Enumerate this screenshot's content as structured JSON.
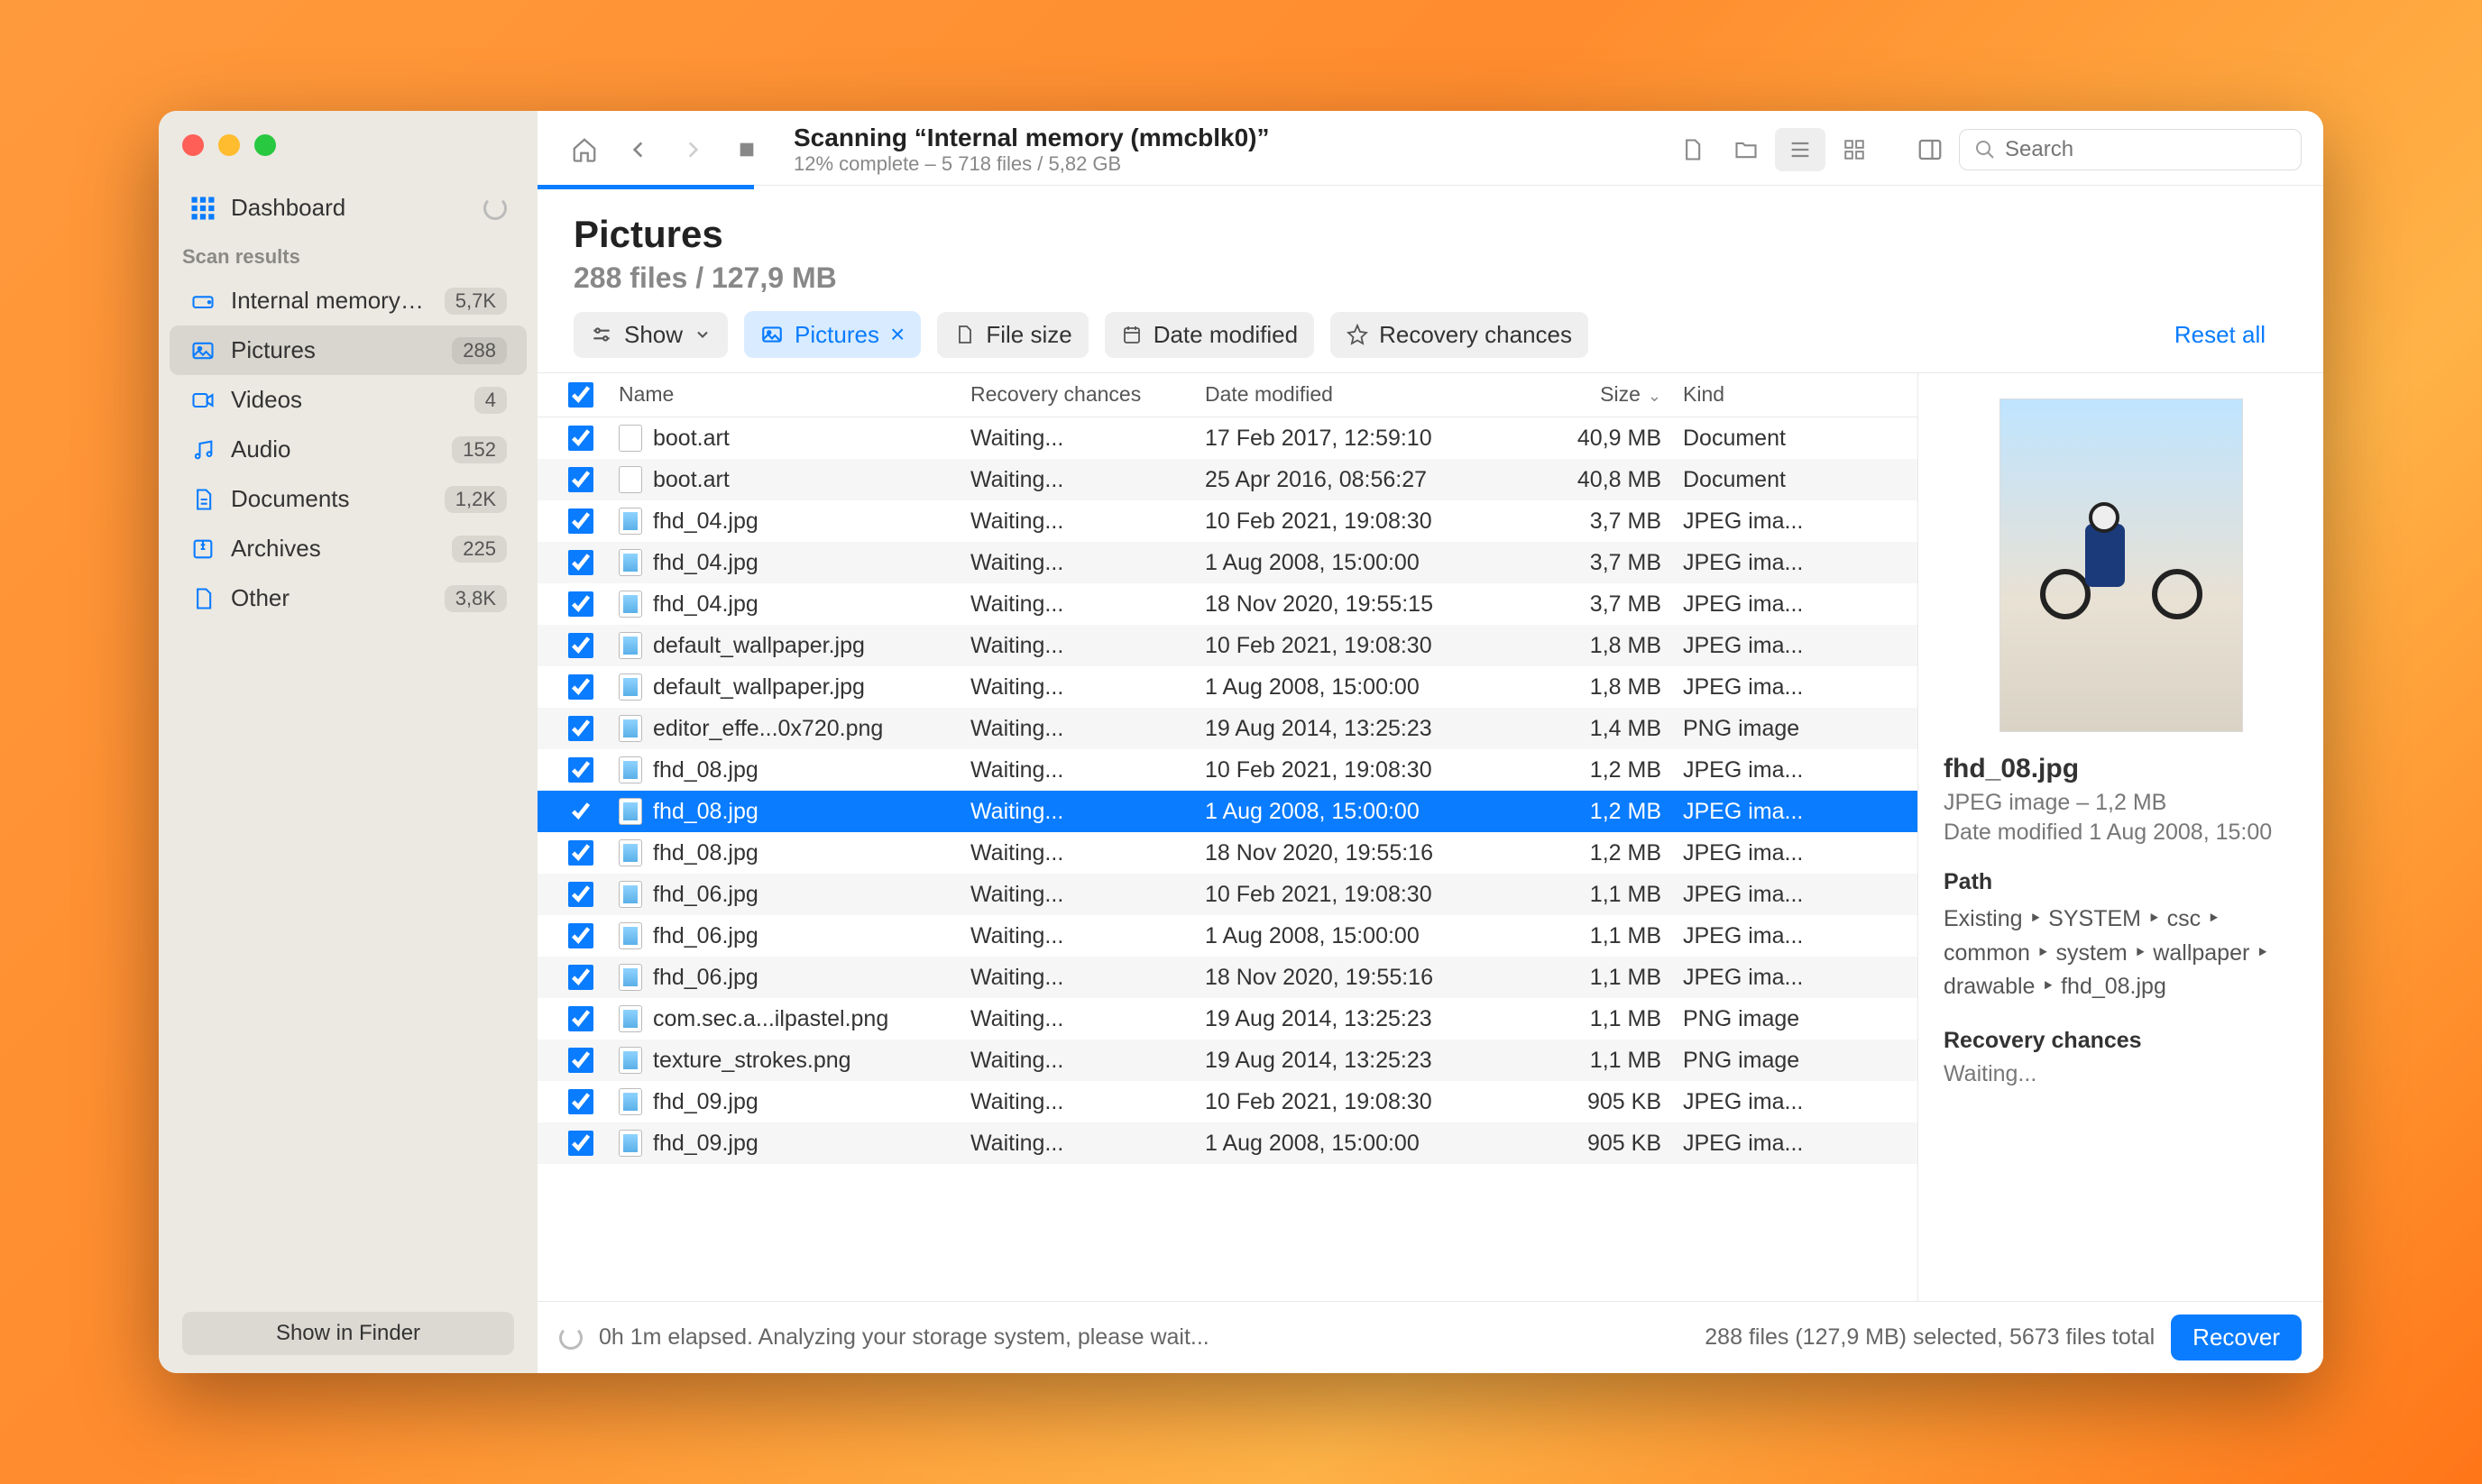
{
  "sidebar": {
    "dashboard": "Dashboard",
    "scan_results_heading": "Scan results",
    "items": [
      {
        "icon": "drive",
        "label": "Internal memory (...",
        "badge": "5,7K"
      },
      {
        "icon": "picture",
        "label": "Pictures",
        "badge": "288"
      },
      {
        "icon": "video",
        "label": "Videos",
        "badge": "4"
      },
      {
        "icon": "audio",
        "label": "Audio",
        "badge": "152"
      },
      {
        "icon": "document",
        "label": "Documents",
        "badge": "1,2K"
      },
      {
        "icon": "archive",
        "label": "Archives",
        "badge": "225"
      },
      {
        "icon": "other",
        "label": "Other",
        "badge": "3,8K"
      }
    ],
    "show_in_finder": "Show in Finder"
  },
  "toolbar": {
    "title": "Scanning “Internal memory (mmcblk0)”",
    "subtitle": "12% complete – 5 718 files / 5,82 GB",
    "search_placeholder": "Search"
  },
  "heading": {
    "title": "Pictures",
    "subtitle": "288 files / 127,9 MB"
  },
  "filters": {
    "show": "Show",
    "pictures": "Pictures",
    "file_size": "File size",
    "date_modified": "Date modified",
    "recovery": "Recovery chances",
    "reset": "Reset all"
  },
  "columns": {
    "name": "Name",
    "recovery": "Recovery chances",
    "date": "Date modified",
    "size": "Size",
    "kind": "Kind"
  },
  "rows": [
    {
      "name": "boot.art",
      "rec": "Waiting...",
      "date": "17 Feb 2017, 12:59:10",
      "size": "40,9 MB",
      "kind": "Document",
      "img": false
    },
    {
      "name": "boot.art",
      "rec": "Waiting...",
      "date": "25 Apr 2016, 08:56:27",
      "size": "40,8 MB",
      "kind": "Document",
      "img": false
    },
    {
      "name": "fhd_04.jpg",
      "rec": "Waiting...",
      "date": "10 Feb 2021, 19:08:30",
      "size": "3,7 MB",
      "kind": "JPEG ima...",
      "img": true
    },
    {
      "name": "fhd_04.jpg",
      "rec": "Waiting...",
      "date": "1 Aug 2008, 15:00:00",
      "size": "3,7 MB",
      "kind": "JPEG ima...",
      "img": true
    },
    {
      "name": "fhd_04.jpg",
      "rec": "Waiting...",
      "date": "18 Nov 2020, 19:55:15",
      "size": "3,7 MB",
      "kind": "JPEG ima...",
      "img": true
    },
    {
      "name": "default_wallpaper.jpg",
      "rec": "Waiting...",
      "date": "10 Feb 2021, 19:08:30",
      "size": "1,8 MB",
      "kind": "JPEG ima...",
      "img": true
    },
    {
      "name": "default_wallpaper.jpg",
      "rec": "Waiting...",
      "date": "1 Aug 2008, 15:00:00",
      "size": "1,8 MB",
      "kind": "JPEG ima...",
      "img": true
    },
    {
      "name": "editor_effe...0x720.png",
      "rec": "Waiting...",
      "date": "19 Aug 2014, 13:25:23",
      "size": "1,4 MB",
      "kind": "PNG image",
      "img": true
    },
    {
      "name": "fhd_08.jpg",
      "rec": "Waiting...",
      "date": "10 Feb 2021, 19:08:30",
      "size": "1,2 MB",
      "kind": "JPEG ima...",
      "img": true
    },
    {
      "name": "fhd_08.jpg",
      "rec": "Waiting...",
      "date": "1 Aug 2008, 15:00:00",
      "size": "1,2 MB",
      "kind": "JPEG ima...",
      "img": true,
      "selected": true
    },
    {
      "name": "fhd_08.jpg",
      "rec": "Waiting...",
      "date": "18 Nov 2020, 19:55:16",
      "size": "1,2 MB",
      "kind": "JPEG ima...",
      "img": true
    },
    {
      "name": "fhd_06.jpg",
      "rec": "Waiting...",
      "date": "10 Feb 2021, 19:08:30",
      "size": "1,1 MB",
      "kind": "JPEG ima...",
      "img": true
    },
    {
      "name": "fhd_06.jpg",
      "rec": "Waiting...",
      "date": "1 Aug 2008, 15:00:00",
      "size": "1,1 MB",
      "kind": "JPEG ima...",
      "img": true
    },
    {
      "name": "fhd_06.jpg",
      "rec": "Waiting...",
      "date": "18 Nov 2020, 19:55:16",
      "size": "1,1 MB",
      "kind": "JPEG ima...",
      "img": true
    },
    {
      "name": "com.sec.a...ilpastel.png",
      "rec": "Waiting...",
      "date": "19 Aug 2014, 13:25:23",
      "size": "1,1 MB",
      "kind": "PNG image",
      "img": true
    },
    {
      "name": "texture_strokes.png",
      "rec": "Waiting...",
      "date": "19 Aug 2014, 13:25:23",
      "size": "1,1 MB",
      "kind": "PNG image",
      "img": true
    },
    {
      "name": "fhd_09.jpg",
      "rec": "Waiting...",
      "date": "10 Feb 2021, 19:08:30",
      "size": "905 KB",
      "kind": "JPEG ima...",
      "img": true
    },
    {
      "name": "fhd_09.jpg",
      "rec": "Waiting...",
      "date": "1 Aug 2008, 15:00:00",
      "size": "905 KB",
      "kind": "JPEG ima...",
      "img": true
    }
  ],
  "detail": {
    "name": "fhd_08.jpg",
    "meta1": "JPEG image – 1,2 MB",
    "meta2": "Date modified 1 Aug 2008, 15:00",
    "path_heading": "Path",
    "path_text": "Existing ‣ SYSTEM ‣ csc ‣ common ‣ system ‣ wallpaper ‣ drawable ‣ fhd_08.jpg",
    "recovery_heading": "Recovery chances",
    "recovery_value": "Waiting..."
  },
  "statusbar": {
    "elapsed": "0h 1m elapsed. Analyzing your storage system, please wait...",
    "summary": "288 files (127,9 MB) selected, 5673 files total",
    "recover": "Recover"
  }
}
